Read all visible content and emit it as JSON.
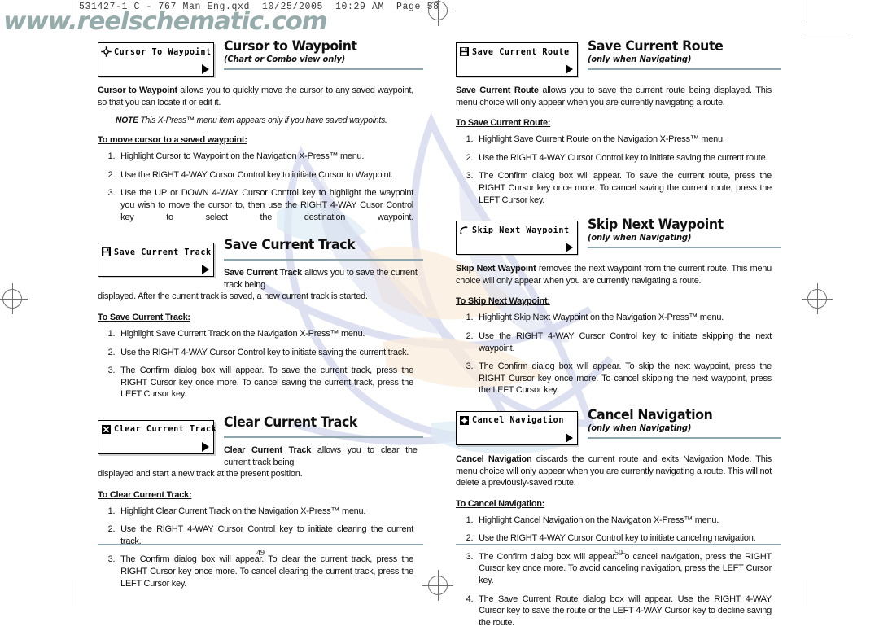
{
  "prepress": {
    "header": "531427-1 C - 767 Man Eng.qxd  10/25/2005  10:29 AM  Page 58"
  },
  "watermark": {
    "text": "www.reelschematic.com",
    "color": "#6e8b8b"
  },
  "colors": {
    "rule": "#8fa6ae",
    "text": "#111111",
    "logo_blue": "#b6bde0",
    "logo_peach": "#f6dcc0",
    "logo_sky": "#c4dced"
  },
  "pages": {
    "left_number": "49",
    "right_number": "50"
  },
  "left_column": {
    "sections": [
      {
        "menu": {
          "icon": "crosshair-target-icon",
          "label": "Cursor To Waypoint",
          "arrow": "right-arrow-icon"
        },
        "title": "Cursor to Waypoint",
        "subtitle": "(Chart or Combo view only)",
        "lead_bold": "Cursor to Waypoint",
        "lead_rest": " allows you to quickly move the cursor to any saved waypoint, so that you can locate it or edit it.",
        "note_label": "NOTE",
        "note_text": "This X-Press™ menu item appears only if you have saved waypoints.",
        "howto": "To move cursor to a saved waypoint:",
        "steps": [
          "Highlight Cursor to Waypoint on the Navigation X-Press™ menu.",
          "Use the RIGHT 4-WAY Cursor Control key to initiate Cursor to Waypoint.",
          "Use the UP or DOWN 4-WAY Cursor Control key to highlight the waypoint you wish to move the cursor to, then use the RIGHT 4-WAY Cusor Control key to select the destination waypoint."
        ]
      },
      {
        "menu": {
          "icon": "floppy-save-icon",
          "label": "Save Current Track",
          "arrow": "right-arrow-icon"
        },
        "title": "Save Current Track",
        "subtitle": "",
        "lead_bold": "Save Current Track",
        "lead_rest": " allows you to save the current track being displayed. After the current track is saved, a new current track is started.",
        "howto": "To Save Current Track:",
        "steps": [
          "Highlight Save Current Track on the Navigation X-Press™ menu.",
          "Use the RIGHT 4-WAY Cursor Control key to initiate saving the current track.",
          "The Confirm dialog box will appear. To save the current track,  press the RIGHT Cursor key once more. To cancel saving the current track, press the LEFT Cursor key."
        ]
      },
      {
        "menu": {
          "icon": "x-cross-clear-icon",
          "label": "Clear Current Track",
          "arrow": "right-arrow-icon"
        },
        "title": "Clear Current Track",
        "subtitle": "",
        "lead_bold": "Clear Current Track",
        "lead_rest": " allows you to clear the current track being displayed and start a new track at the present position.",
        "howto": "To Clear Current Track:",
        "steps": [
          "Highlight Clear Current Track on the Navigation X-Press™ menu.",
          "Use the RIGHT 4-WAY Cursor Control key to initiate clearing the current track.",
          "The Confirm dialog box will appear. To clear the current track,  press the RIGHT Cursor key once more. To cancel clearing the current track, press the LEFT Cursor key."
        ]
      }
    ]
  },
  "right_column": {
    "sections": [
      {
        "menu": {
          "icon": "floppy-save-icon",
          "label": "Save Current Route",
          "arrow": "right-arrow-icon"
        },
        "title": "Save Current Route",
        "subtitle": "(only when Navigating)",
        "lead_bold": "Save Current Route",
        "lead_rest": " allows you to save the current route being displayed. This menu choice will only appear when you are currently navigating a route.",
        "howto": "To Save Current Route:",
        "steps": [
          "Highlight Save Current Route on the Navigation X-Press™ menu.",
          "Use the RIGHT 4-WAY Cursor Control key to initiate saving the current route.",
          "The Confirm dialog box will appear. To save the current route,  press the RIGHT Cursor key once more. To cancel saving the current route, press the LEFT Cursor key."
        ]
      },
      {
        "menu": {
          "icon": "skip-arrow-icon",
          "label": "Skip Next Waypoint",
          "arrow": "right-arrow-icon"
        },
        "title": "Skip Next Waypoint",
        "subtitle": "(only when Navigating)",
        "lead_bold": "Skip Next Waypoint",
        "lead_rest": " removes the next waypoint from the current route. This menu choice will only appear when you are currently navigating a route.",
        "howto": "To Skip Next Waypoint:",
        "steps": [
          "Highlight Skip Next Waypoint on the Navigation X-Press™ menu.",
          "Use the RIGHT 4-WAY Cursor Control key to initiate skipping the next waypoint.",
          "The Confirm dialog box will appear. To skip the next waypoint,  press the RIGHT Cursor key once more. To cancel skipping the next waypoint, press the LEFT Cursor key."
        ]
      },
      {
        "menu": {
          "icon": "cancel-navigation-icon",
          "label": "Cancel Navigation",
          "arrow": "right-arrow-icon"
        },
        "title": "Cancel Navigation",
        "subtitle": "(only when Navigating)",
        "lead_bold": "Cancel Navigation",
        "lead_rest": " discards the current route and exits Navigation Mode. This menu choice will only appear when you are currently navigating a route. This will not delete a previously-saved route.",
        "howto": "To Cancel Navigation:",
        "steps": [
          "Highlight Cancel Navigation on the Navigation X-Press™ menu.",
          "Use the RIGHT 4-WAY Cursor Control key to initiate canceling navigation.",
          "The Confirm dialog box will appear. To cancel navigation,  press the RIGHT Cursor key once more. To avoid canceling navigation, press the LEFT Cursor key.",
          "The Save Current Route dialog box will appear.  Use the RIGHT 4-WAY Cursor key to save the route or the LEFT 4-WAY Cursor key to decline saving the route."
        ]
      }
    ]
  }
}
